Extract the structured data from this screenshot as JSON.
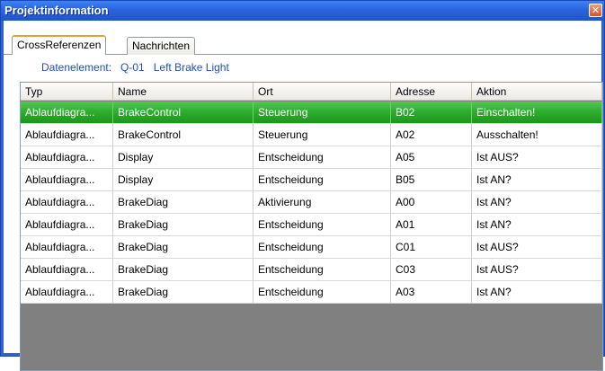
{
  "window": {
    "title": "Projektinformation",
    "close_glyph": "✕"
  },
  "tabs": [
    {
      "label": "CrossReferenzen",
      "active": true
    },
    {
      "label": "Nachrichten",
      "active": false
    }
  ],
  "data_element": {
    "label": "Datenelement:",
    "id": "Q-01",
    "name": "Left Brake Light"
  },
  "table": {
    "columns": [
      "Typ",
      "Name",
      "Ort",
      "Adresse",
      "Aktion"
    ],
    "rows": [
      [
        "Ablaufdiagra...",
        "BrakeControl",
        "Steuerung",
        "B02",
        "Einschalten!"
      ],
      [
        "Ablaufdiagra...",
        "BrakeControl",
        "Steuerung",
        "A02",
        "Ausschalten!"
      ],
      [
        "Ablaufdiagra...",
        "Display",
        "Entscheidung",
        "A05",
        "Ist AUS?"
      ],
      [
        "Ablaufdiagra...",
        "Display",
        "Entscheidung",
        "B05",
        "Ist AN?"
      ],
      [
        "Ablaufdiagra...",
        "BrakeDiag",
        "Aktivierung",
        "A00",
        "Ist AN?"
      ],
      [
        "Ablaufdiagra...",
        "BrakeDiag",
        "Entscheidung",
        "A01",
        "Ist AN?"
      ],
      [
        "Ablaufdiagra...",
        "BrakeDiag",
        "Entscheidung",
        "C01",
        "Ist AUS?"
      ],
      [
        "Ablaufdiagra...",
        "BrakeDiag",
        "Entscheidung",
        "C03",
        "Ist AUS?"
      ],
      [
        "Ablaufdiagra...",
        "BrakeDiag",
        "Entscheidung",
        "A03",
        "Ist AN?"
      ]
    ],
    "selected_row": 0
  },
  "colors": {
    "title_bar": "#2a64dc",
    "selection": "#2fae2f",
    "link_text": "#1f4fbf",
    "empty_area": "#808080"
  }
}
